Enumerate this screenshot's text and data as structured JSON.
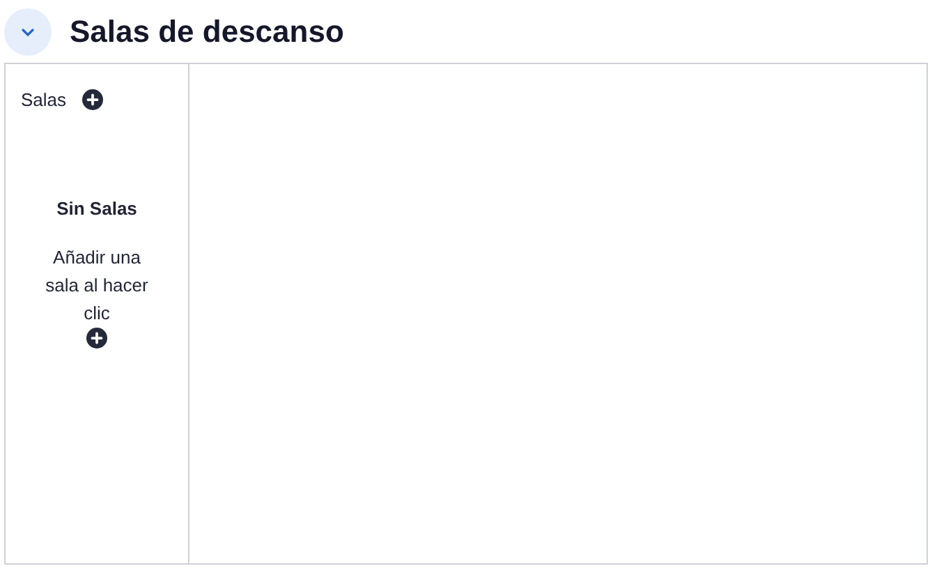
{
  "header": {
    "title": "Salas de descanso",
    "expanded": true
  },
  "sidebar": {
    "heading": "Salas",
    "empty_title": "Sin Salas",
    "empty_text": "Añadir una sala al hacer clic"
  }
}
